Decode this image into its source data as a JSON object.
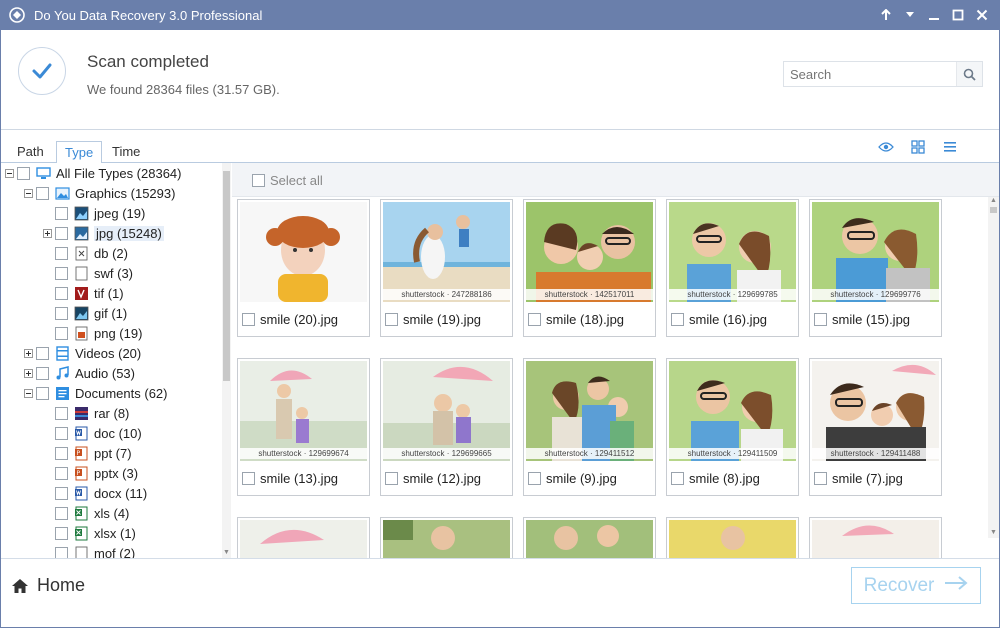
{
  "window": {
    "title": "Do You Data Recovery 3.0 Professional",
    "controls": [
      "arrow-up-icon",
      "arrow-down-icon",
      "minimize-icon",
      "maximize-icon",
      "close-icon"
    ]
  },
  "header": {
    "status_title": "Scan completed",
    "status_sub": "We found 28364 files (31.57 GB).",
    "search": {
      "placeholder": "Search",
      "value": ""
    }
  },
  "tabs": [
    {
      "label": "Path",
      "active": false
    },
    {
      "label": "Type",
      "active": true
    },
    {
      "label": "Time",
      "active": false
    }
  ],
  "view_icons": [
    "eye-icon",
    "grid-view-icon",
    "list-view-icon"
  ],
  "tree": {
    "root": {
      "label": "All File Types (28364)"
    },
    "graphics": {
      "label": "Graphics (15293)",
      "children": [
        "jpeg (19)",
        "jpg (15248)",
        "db (2)",
        "swf (3)",
        "tif (1)",
        "gif (1)",
        "png (19)"
      ]
    },
    "videos": {
      "label": "Videos (20)"
    },
    "audio": {
      "label": "Audio (53)"
    },
    "documents": {
      "label": "Documents (62)",
      "children": [
        "rar (8)",
        "doc (10)",
        "ppt (7)",
        "pptx (3)",
        "docx (11)",
        "xls (4)",
        "xlsx (1)",
        "mof (2)"
      ]
    }
  },
  "content": {
    "select_all": "Select all",
    "files": [
      {
        "name": "smile (20).jpg",
        "watermark": ""
      },
      {
        "name": "smile (19).jpg",
        "watermark": "shutterstock · 247288186"
      },
      {
        "name": "smile (18).jpg",
        "watermark": "shutterstock · 142517011"
      },
      {
        "name": "smile (16).jpg",
        "watermark": "shutterstock · 129699785"
      },
      {
        "name": "smile (15).jpg",
        "watermark": "shutterstock · 129699776"
      },
      {
        "name": "smile (13).jpg",
        "watermark": "shutterstock · 129699674"
      },
      {
        "name": "smile (12).jpg",
        "watermark": "shutterstock · 129699665"
      },
      {
        "name": "smile (9).jpg",
        "watermark": "shutterstock · 129411512"
      },
      {
        "name": "smile (8).jpg",
        "watermark": "shutterstock · 129411509"
      },
      {
        "name": "smile (7).jpg",
        "watermark": "shutterstock · 129411488"
      }
    ]
  },
  "footer": {
    "home_label": "Home",
    "recover_label": "Recover"
  },
  "colors": {
    "titlebar": "#6a7fab",
    "accent": "#3b8ad6",
    "recover_disabled": "#a7d3ef"
  }
}
